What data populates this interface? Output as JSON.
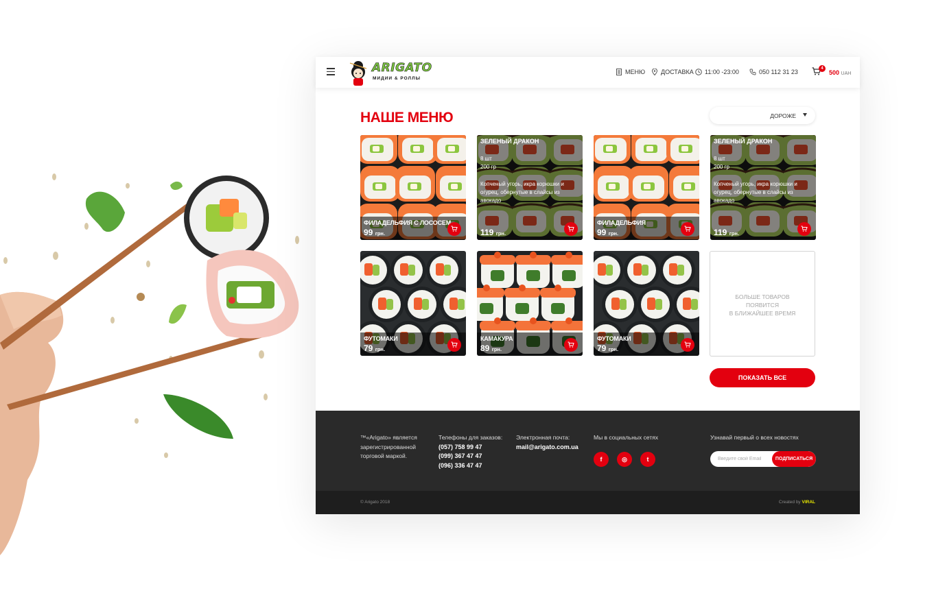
{
  "brand": {
    "name": "ARIGATO",
    "tagline": "МИДИИ & РОЛЛЫ"
  },
  "nav": {
    "menu": "МЕНЮ",
    "delivery": "ДОСТАВКА",
    "hours": "11:00 -23:00",
    "phone": "050 112 31 23",
    "cart_count": "4",
    "cart_total": "500",
    "cart_currency": "UAH"
  },
  "section": {
    "title": "НАШЕ МЕНЮ",
    "sort_label": "ДОРОЖЕ"
  },
  "products": [
    {
      "name": "ФИЛАДЕЛЬФИЯ С ЛОСОСЕМ",
      "price": "99",
      "currency": "грн.",
      "image": "salmon-roll"
    },
    {
      "name": "ЗЕЛЕНЫЙ ДРАКОН",
      "price": "119",
      "currency": "грн.",
      "image": "dragon-roll",
      "details_open": true,
      "qty": "8 шт",
      "weight": "200 гр",
      "description": "Копченый угорь, икра корюшки и огурец, обернутые в слайсы из авокадо"
    },
    {
      "name": "ФИЛАДЕЛЬФИЯ",
      "price": "99",
      "currency": "грн.",
      "image": "salmon-roll"
    },
    {
      "name": "ЗЕЛЕНЫЙ ДРАКОН",
      "price": "119",
      "currency": "грн.",
      "image": "dragon-roll",
      "details_open": true,
      "qty": "8 шт",
      "weight": "200 гр",
      "description": "Копченый угорь, икра корюшки и огурец, обернутые в слайсы из авокадо"
    },
    {
      "name": "ФУТОМАКИ",
      "price": "79",
      "currency": "грн.",
      "image": "futomaki"
    },
    {
      "name": "КАМАКУРА",
      "price": "89",
      "currency": "грн.",
      "image": "kamakura"
    },
    {
      "name": "ФУТОМАКИ",
      "price": "79",
      "currency": "грн.",
      "image": "futomaki"
    }
  ],
  "more": {
    "text": "БОЛЬШЕ ТОВАРОВ\nПОЯВИТСЯ\nВ БЛИЖАЙШЕЕ ВРЕМЯ"
  },
  "show_all": "ПОКАЗАТЬ ВСЕ",
  "footer": {
    "trademark": [
      "™«Arigato» является",
      "зарегистрированной",
      "торговой маркой."
    ],
    "phones_title": "Телефоны для заказов:",
    "phones": [
      "(057) 758 99 47",
      "(099) 367 47 47",
      "(096) 336 47 47"
    ],
    "email_title": "Электронная почта:",
    "email": "mail@arigato.com.ua",
    "social_title": "Мы в социальных сетях",
    "social": [
      {
        "icon": "facebook-icon",
        "glyph": "f"
      },
      {
        "icon": "instagram-icon",
        "glyph": "◎"
      },
      {
        "icon": "twitter-icon",
        "glyph": "t"
      }
    ],
    "news_title": "Узнавай первый о всех новостях",
    "email_placeholder": "Введите свой Email",
    "subscribe": "ПОДПИСАТЬСЯ",
    "copyright": "© Arigato 2018",
    "created_by": "Created by",
    "agency": "VIRAL"
  },
  "colors": {
    "accent": "#e3000f",
    "footer_bg": "#2a2a2a",
    "logo_green": "#7bc341"
  }
}
